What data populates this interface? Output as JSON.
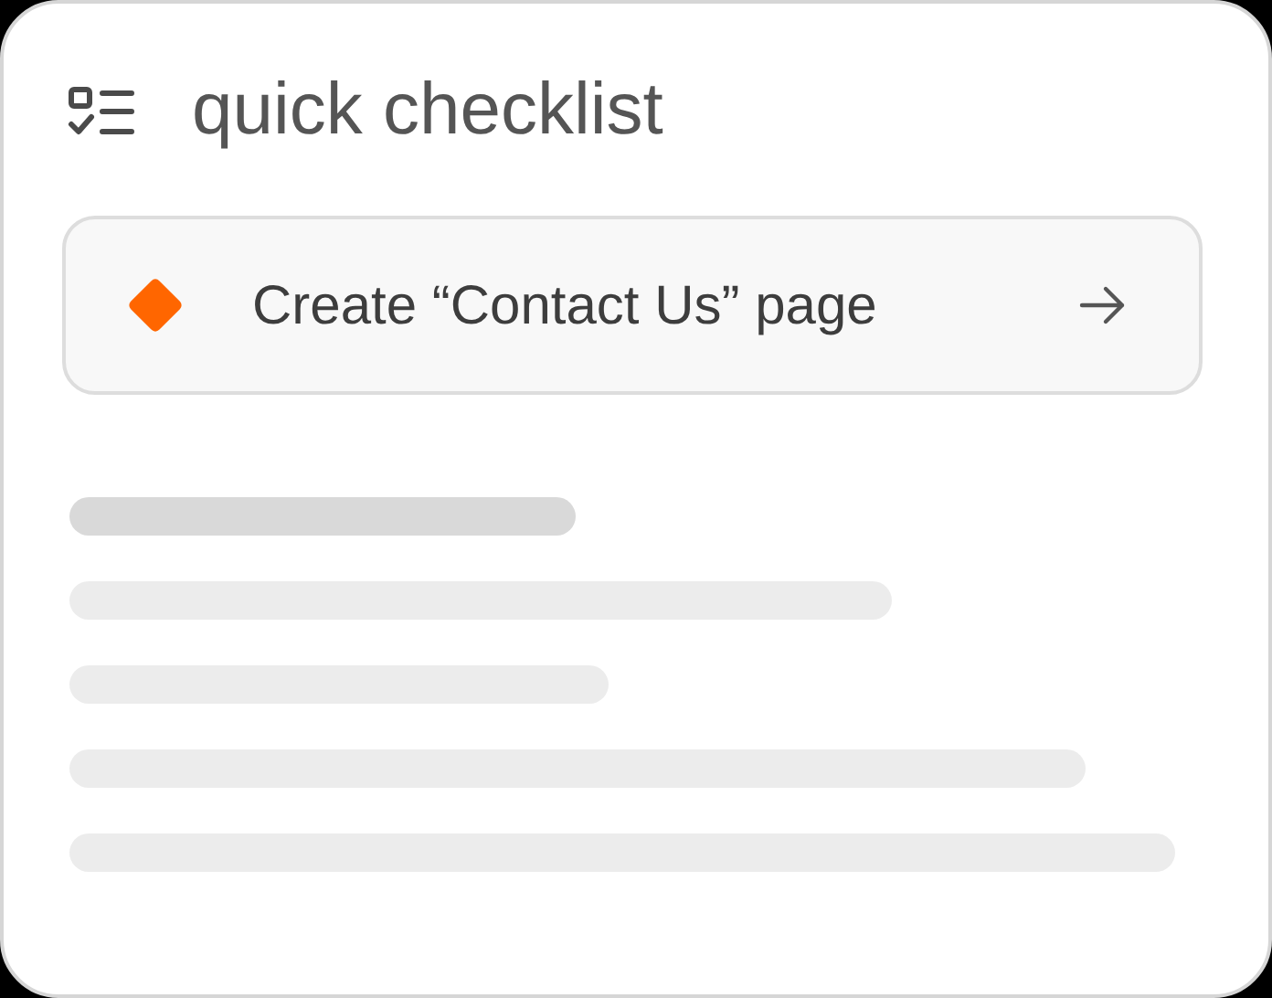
{
  "title": "quick checklist",
  "task": {
    "label": "Create “Contact Us” page",
    "color": "#ff6600"
  }
}
